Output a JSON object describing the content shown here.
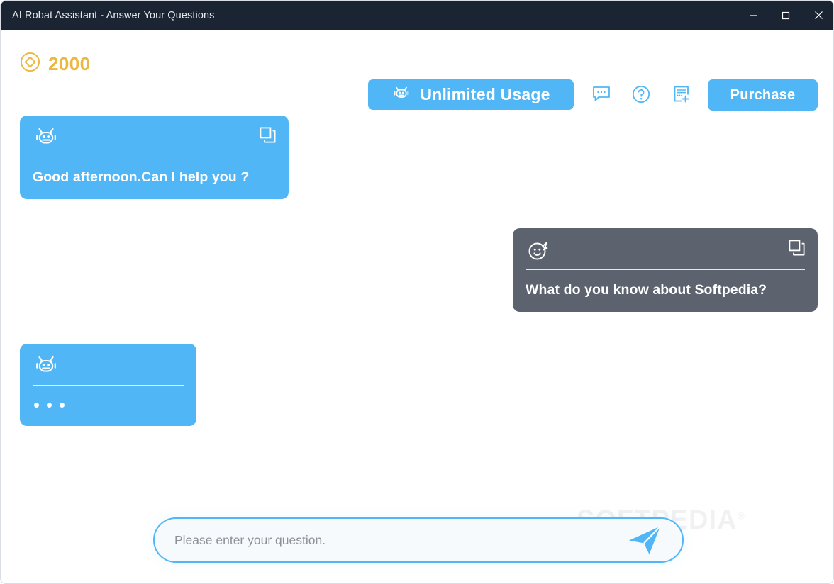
{
  "window": {
    "title": "AI Robat Assistant - Answer Your Questions",
    "controls": {
      "minimize": "minimize-button",
      "maximize": "maximize-button",
      "close": "close-button"
    },
    "titlebar_bg": "#1b2433"
  },
  "header": {
    "coin_icon": "diamond-token-icon",
    "coin_count": "2000",
    "coin_color": "#ecb73f",
    "unlimited": {
      "label": "Unlimited Usage",
      "icon": "robot-icon",
      "color": "#51b6f6"
    },
    "icons": [
      {
        "name": "chat-bubble-icon",
        "title": "Chat"
      },
      {
        "name": "question-mark-icon",
        "title": "Help"
      },
      {
        "name": "new-note-icon",
        "title": "New note"
      }
    ],
    "purchase_label": "Purchase",
    "accent_color": "#51b6f6"
  },
  "chat": {
    "messages": [
      {
        "role": "assistant",
        "avatar_icon": "robot-icon",
        "action_icon": "copy-icon",
        "text": "Good afternoon.Can I help you ?",
        "bubble_color": "#51b6f6"
      },
      {
        "role": "user",
        "avatar_icon": "smiley-face-icon",
        "action_icon": "copy-icon",
        "text": "What do you know about Softpedia?",
        "bubble_color": "#5c636e"
      },
      {
        "role": "assistant",
        "avatar_icon": "robot-icon",
        "text": "typing",
        "bubble_color": "#51b6f6"
      }
    ]
  },
  "composer": {
    "placeholder": "Please enter your question.",
    "value": "",
    "send_icon": "paper-plane-icon",
    "border_color": "#51b6f6"
  },
  "watermark": {
    "text": "SOFTPEDIA",
    "mark": "®"
  }
}
